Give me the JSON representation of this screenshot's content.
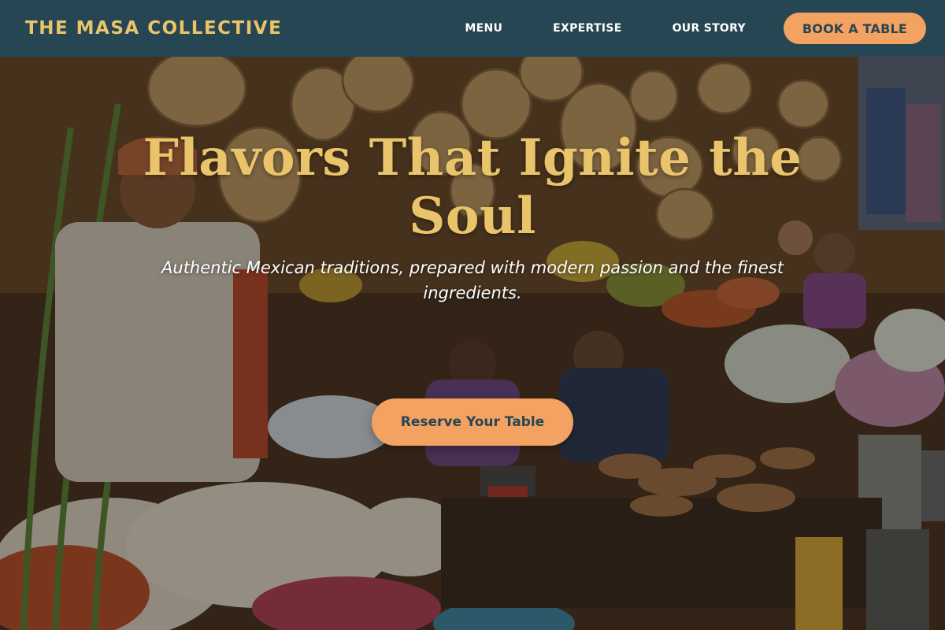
{
  "header": {
    "brand": "THE MASA COLLECTIVE",
    "nav": {
      "menu": "MENU",
      "expertise": "EXPERTISE",
      "our_story": "OUR STORY"
    },
    "book_button": "BOOK A TABLE"
  },
  "hero": {
    "title": "Flavors That Ignite the Soul",
    "subtitle": "Authentic Mexican traditions, prepared with modern passion and the finest ingredients.",
    "cta": "Reserve Your Table"
  },
  "colors": {
    "header_bg": "#264653",
    "brand_gold": "#e9c46a",
    "accent_orange": "#f4a261",
    "text_white": "#ffffff"
  }
}
